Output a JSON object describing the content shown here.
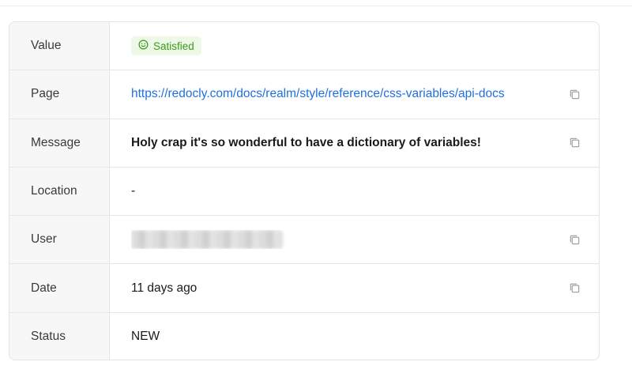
{
  "rows": [
    {
      "label": "Value",
      "badge": {
        "text": "Satisfied",
        "icon": "smile-icon",
        "bg": "#edf8e6",
        "color": "#3d9a1e"
      }
    },
    {
      "label": "Page",
      "value": "https://redocly.com/docs/realm/style/reference/css-variables/api-docs",
      "copyable": true
    },
    {
      "label": "Message",
      "value": "Holy crap it's so wonderful to have a dictionary of variables!",
      "copyable": true
    },
    {
      "label": "Location",
      "value": "-"
    },
    {
      "label": "User",
      "value": "",
      "redacted": true,
      "copyable": true
    },
    {
      "label": "Date",
      "value": "11 days ago",
      "copyable": true
    },
    {
      "label": "Status",
      "value": "NEW"
    }
  ],
  "colors": {
    "link": "#1f6fe0",
    "label_bg": "#f7f7f7",
    "border": "#e4e4e4"
  }
}
